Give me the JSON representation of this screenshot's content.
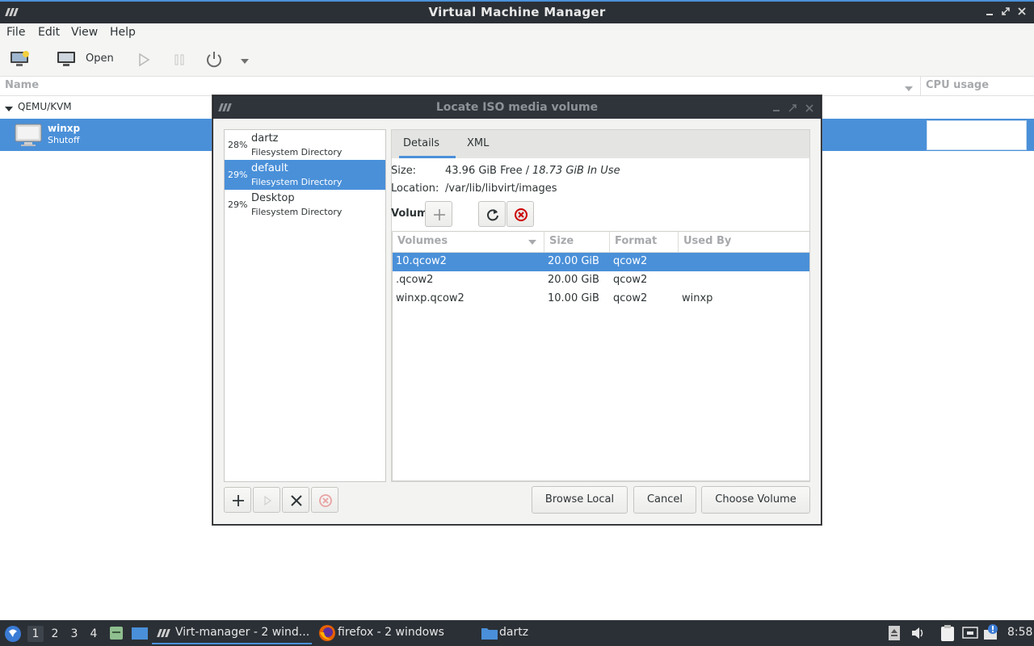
{
  "window": {
    "title": "Virtual Machine Manager"
  },
  "menubar": {
    "items": [
      "File",
      "Edit",
      "View",
      "Help"
    ]
  },
  "toolbar": {
    "open_label": "Open"
  },
  "columns": {
    "name": "Name",
    "cpu": "CPU usage"
  },
  "group": {
    "label": "QEMU/KVM"
  },
  "vm": {
    "name": "winxp",
    "state": "Shutoff"
  },
  "dialog": {
    "title": "Locate ISO media volume",
    "pools": [
      {
        "pct": "28%",
        "name": "dartz",
        "type": "Filesystem Directory"
      },
      {
        "pct": "29%",
        "name": "default",
        "type": "Filesystem Directory"
      },
      {
        "pct": "29%",
        "name": "Desktop",
        "type": "Filesystem Directory"
      }
    ],
    "tabs": [
      "Details",
      "XML"
    ],
    "size_label": "Size:",
    "size_free": "43.96 GiB Free / ",
    "size_used": "18.73 GiB In Use",
    "location_label": "Location:",
    "location_value": "/var/lib/libvirt/images",
    "volumes_label": "Volumes",
    "table": {
      "headers": [
        "Volumes",
        "Size",
        "Format",
        "Used By"
      ],
      "rows": [
        {
          "name": "10.qcow2",
          "size": "20.00 GiB",
          "format": "qcow2",
          "used_by": ""
        },
        {
          "name": ".qcow2",
          "size": "20.00 GiB",
          "format": "qcow2",
          "used_by": ""
        },
        {
          "name": "winxp.qcow2",
          "size": "10.00 GiB",
          "format": "qcow2",
          "used_by": "winxp"
        }
      ]
    },
    "buttons": {
      "browse": "Browse Local",
      "cancel": "Cancel",
      "choose": "Choose Volume"
    }
  },
  "taskbar": {
    "workspaces": [
      "1",
      "2",
      "3",
      "4"
    ],
    "tasks": [
      "Virt-manager - 2 wind...",
      "firefox - 2 windows",
      "dartz"
    ],
    "clock": "8:58"
  },
  "colors": {
    "accent": "#4a90d9",
    "titlebar": "#2b3036"
  }
}
